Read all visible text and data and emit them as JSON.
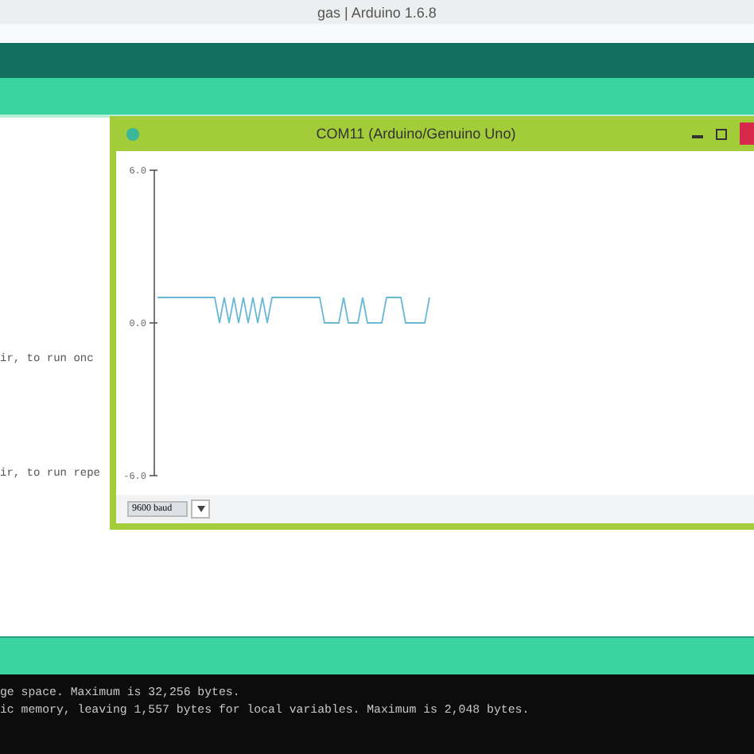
{
  "window": {
    "title": "gas | Arduino 1.6.8"
  },
  "editor": {
    "lines": [
      "ir, to run onc",
      "ir, to run repe"
    ]
  },
  "plotter": {
    "title": "COM11 (Arduino/Genuino Uno)",
    "baud": "9600 baud",
    "chart_data": {
      "type": "line",
      "ylim": [
        -6,
        6
      ],
      "yticks": [
        {
          "value": 6,
          "label": "6.0"
        },
        {
          "value": 0,
          "label": "0.0"
        },
        {
          "value": -6,
          "label": "-6.0"
        }
      ],
      "series": [
        {
          "color": "#6ab8d8",
          "values": [
            1,
            1,
            1,
            1,
            1,
            1,
            1,
            1,
            1,
            1,
            1,
            1,
            1,
            0,
            1,
            0,
            1,
            0,
            1,
            0,
            1,
            0,
            1,
            0,
            1,
            1,
            1,
            1,
            1,
            1,
            1,
            1,
            1,
            1,
            1,
            0,
            0,
            0,
            0,
            1,
            0,
            0,
            0,
            1,
            0,
            0,
            0,
            0,
            1,
            1,
            1,
            1,
            0,
            0,
            0,
            0,
            0,
            1
          ]
        }
      ]
    }
  },
  "console": {
    "lines": [
      "ge space. Maximum is 32,256 bytes.",
      "ic memory, leaving 1,557 bytes for local variables. Maximum is 2,048 bytes."
    ]
  }
}
